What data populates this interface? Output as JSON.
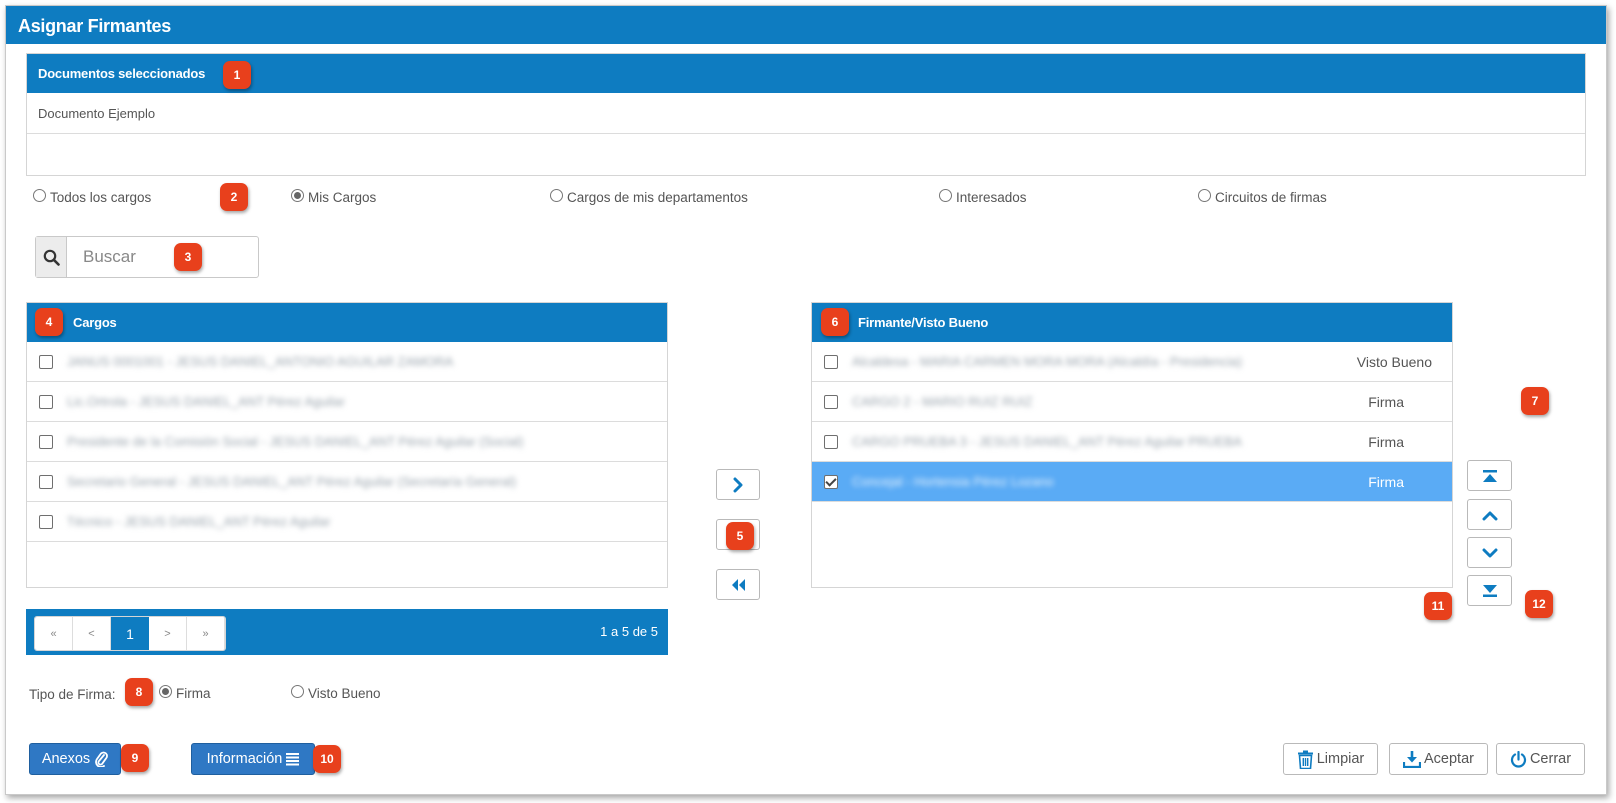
{
  "window": {
    "title": "Asignar Firmantes"
  },
  "documents": {
    "header": "Documentos seleccionados",
    "items": [
      "Documento Ejemplo"
    ]
  },
  "filters": {
    "options": [
      {
        "label": "Todos los cargos",
        "selected": false
      },
      {
        "label": "Mis Cargos",
        "selected": true
      },
      {
        "label": "Cargos de mis departamentos",
        "selected": false
      },
      {
        "label": "Interesados",
        "selected": false
      },
      {
        "label": "Circuitos de firmas",
        "selected": false
      }
    ]
  },
  "search": {
    "placeholder": "Buscar",
    "icon": "search-icon"
  },
  "cargos": {
    "header": "Cargos",
    "rows": [
      {
        "text": "JANUS 0001001 - JESUS DANIEL_ANTONIO AGUILAR ZAMORA",
        "checked": false
      },
      {
        "text": "Lic.Ortrola - JESUS DANIEL_ANT Pérez Aguilar",
        "checked": false
      },
      {
        "text": "Presidente de la Comisión Social - JESUS DANIEL_ANT Pérez Aguilar (Social)",
        "checked": false
      },
      {
        "text": "Secretario General - JESUS DANIEL_ANT Pérez Aguilar (Secretaría General)",
        "checked": false
      },
      {
        "text": "Técnico - JESUS DANIEL_ANT Pérez Aguilar",
        "checked": false
      }
    ]
  },
  "pager": {
    "first": "«",
    "prev": "<",
    "current": "1",
    "next": ">",
    "last": "»",
    "count": "1 a 5 de 5"
  },
  "firmantes": {
    "header": "Firmante/Visto Bueno",
    "rows": [
      {
        "text": "Alcaldesa - MARIA CARMEN MORA MORA (Alcaldía - Presidencia)",
        "type": "Visto Bueno",
        "checked": false,
        "selected": false
      },
      {
        "text": "CARGO 2 - MARIO RUIZ RUIZ",
        "type": "Firma",
        "checked": false,
        "selected": false
      },
      {
        "text": "CARGO PRUEBA 3 - JESUS DANIEL_ANT Pérez Aguilar PRUEBA",
        "type": "Firma",
        "checked": false,
        "selected": false
      },
      {
        "text": "Concejal - Hortensia Pérez Lozano",
        "type": "Firma",
        "checked": true,
        "selected": true
      }
    ]
  },
  "tipo_firma": {
    "label": "Tipo de Firma:",
    "options": [
      {
        "label": "Firma",
        "selected": true
      },
      {
        "label": "Visto Bueno",
        "selected": false
      }
    ]
  },
  "buttons": {
    "anexos": "Anexos",
    "informacion": "Información",
    "limpiar": "Limpiar",
    "aceptar": "Aceptar",
    "cerrar": "Cerrar"
  },
  "badges": [
    "1",
    "2",
    "3",
    "4",
    "5",
    "6",
    "7",
    "8",
    "9",
    "10",
    "11",
    "12"
  ],
  "colors": {
    "header_blue": "#0e7cc1",
    "badge": "#e8401c",
    "selected_row": "#5aabf5",
    "button_blue": "#2f78c4"
  }
}
